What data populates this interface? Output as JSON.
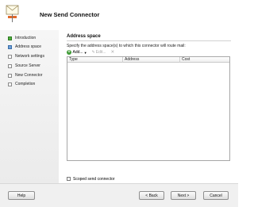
{
  "header": {
    "title": "New Send Connector",
    "icon": "wizard-envelope-icon"
  },
  "steps": [
    {
      "label": "Introduction",
      "state": "done"
    },
    {
      "label": "Address space",
      "state": "active"
    },
    {
      "label": "Network settings",
      "state": "pending"
    },
    {
      "label": "Source Server",
      "state": "pending"
    },
    {
      "label": "New Connector",
      "state": "pending"
    },
    {
      "label": "Completion",
      "state": "pending"
    }
  ],
  "main": {
    "section_title": "Address space",
    "instruction": "Specify the address space(s) to which this connector will route mail:",
    "toolbar": {
      "add_label": "Add...",
      "edit_label": "Edit...",
      "add_icon": "plus-icon",
      "edit_icon": "pencil-icon",
      "remove_icon": "x-icon"
    },
    "grid": {
      "columns": [
        "Type",
        "Address",
        "Cost"
      ],
      "rows": []
    },
    "scoped_label": "Scoped send connector",
    "scoped_checked": false
  },
  "footer": {
    "help": "Help",
    "back": "< Back",
    "next": "Next >",
    "cancel": "Cancel"
  },
  "colors": {
    "done": "#4fae3d",
    "active": "#6fa0d8"
  }
}
